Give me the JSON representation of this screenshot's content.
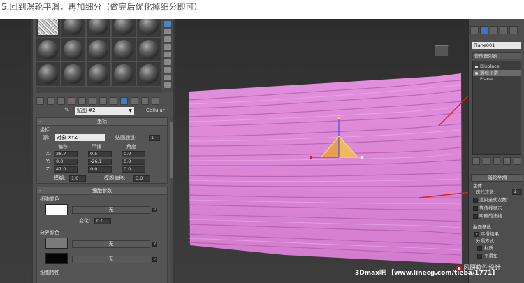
{
  "caption": "5.回到涡轮平滑，再加细分（做完后优化掉细分即可）",
  "material_editor": {
    "map_name": "贴图 #2",
    "map_type": "Cellular",
    "coords_rollout": {
      "title": "坐标",
      "group_label": "坐标",
      "source_label": "源:",
      "source_value": "对象 XYZ",
      "channel_label": "贴图通道:",
      "channel_value": "1",
      "offset_label": "偏移",
      "tiling_label": "平铺",
      "angle_label": "角度",
      "x_label": "X:",
      "y_label": "Y:",
      "z_label": "Z:",
      "x_offset": "28.7",
      "y_offset": "0.0",
      "z_offset": "47.0",
      "x_tiling": "0.5",
      "y_tiling": "-26.1",
      "z_tiling": "0.0",
      "x_angle": "0.0",
      "y_angle": "0.0",
      "z_angle": "0.0",
      "blur_label": "模糊:",
      "blur_value": "1.0",
      "blur_offset_label": "模糊偏移:",
      "blur_offset_value": "0.0"
    },
    "cell_rollout": {
      "title": "细胞参数",
      "cell_color_label": "细胞颜色",
      "none_label_1": "无",
      "variation_label": "变化:",
      "variation_value": "0.0",
      "division_color_label": "分界颜色",
      "none_label_2": "无",
      "none_label_3": "无",
      "cell_chars_label": "细胞特性"
    }
  },
  "command_panel": {
    "object_name": "Plane001",
    "modifier_list": "修改器列表",
    "stack": [
      {
        "label": "Displace"
      },
      {
        "label": "涡轮平滑"
      },
      {
        "label": "Plane"
      }
    ],
    "turbosmooth": {
      "title": "涡轮平滑",
      "main_label": "主体",
      "iterations_label": "迭代次数:",
      "iterations_value": "2",
      "render_iters_label": "渲染迭代次数:",
      "iso_label": "等值线显示",
      "explicit_label": "明确的法线",
      "surface_label": "曲面参数",
      "smooth_result_label": "平滑结果",
      "sep_label": "分隔方式:",
      "material_label": "材质",
      "smoothing_label": "平滑组"
    }
  },
  "watermark": {
    "text": "3Dmax吧 【www.linecg.com/tieba/1771】",
    "side_text": "风研软件设计"
  },
  "colors": {
    "plane": "#d884d4",
    "plane_dark": "#b560b3",
    "arrow": "#e02020",
    "accent": "#3a78c0"
  }
}
